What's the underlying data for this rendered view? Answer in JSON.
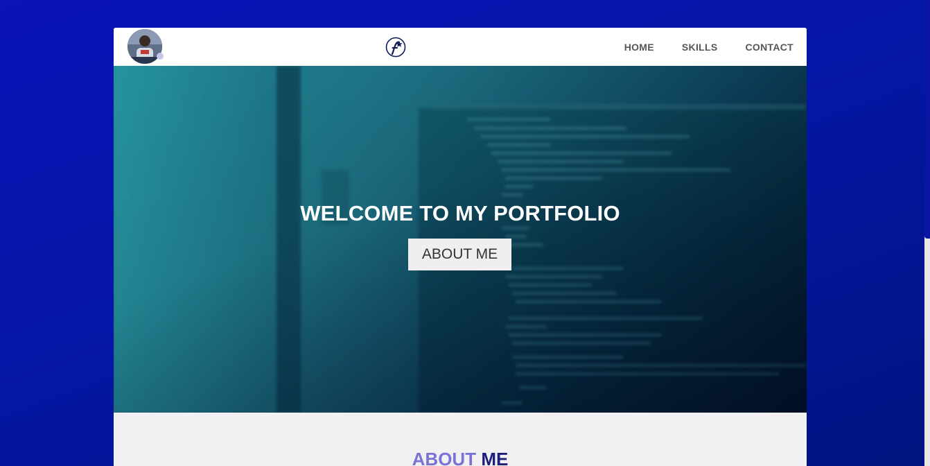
{
  "navbar": {
    "links": [
      "HOME",
      "SKILLS",
      "CONTACT"
    ]
  },
  "hero": {
    "title": "WELCOME TO MY PORTFOLIO",
    "button_label": "ABOUT ME"
  },
  "about": {
    "heading_part1": "ABOUT",
    "heading_part2": "ME"
  },
  "colors": {
    "page_background": "#0517a6",
    "navbar_background": "#ffffff",
    "nav_link": "#555555",
    "hero_title": "#ffffff",
    "button_background": "#f0eef0",
    "about_accent": "#7b72d6",
    "about_dark": "#1b1f7a",
    "logo_navy": "#0d1a5a"
  },
  "icons": {
    "avatar": "profile-photo",
    "logo": "f-star-logo"
  }
}
